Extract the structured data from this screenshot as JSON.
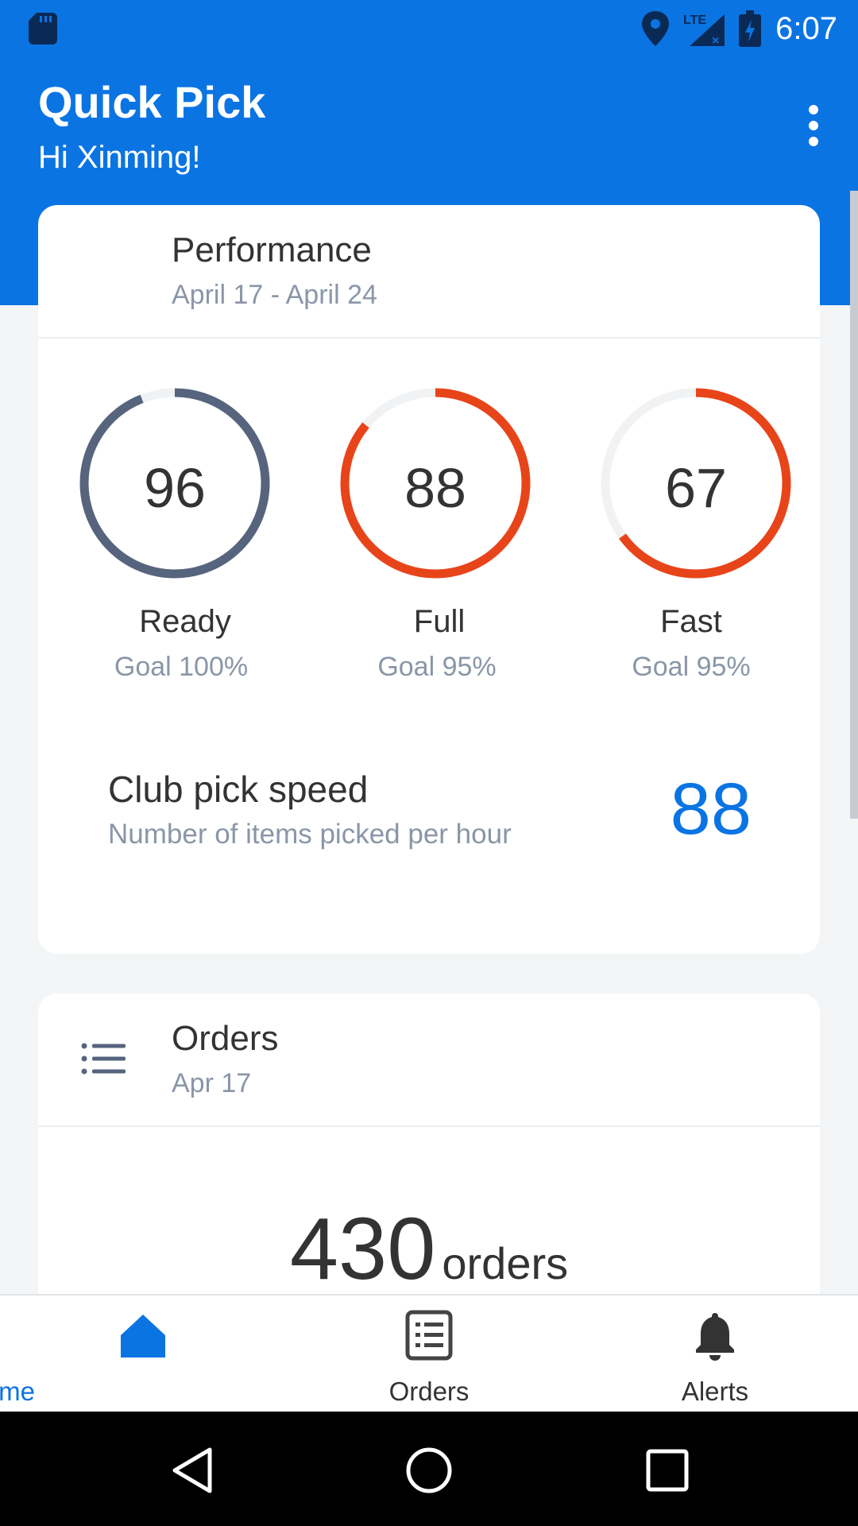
{
  "status_bar": {
    "time": "6:07",
    "network": "LTE"
  },
  "header": {
    "title": "Quick Pick",
    "greeting": "Hi Xinming!"
  },
  "performance": {
    "title": "Performance",
    "date_range": "April 17 - April 24",
    "metrics": [
      {
        "label": "Ready",
        "value": "96",
        "goal": "Goal 100%",
        "progress": 0.96,
        "color": "#56647e"
      },
      {
        "label": "Full",
        "value": "88",
        "goal": "Goal 95%",
        "progress": 0.88,
        "color": "#e8441a"
      },
      {
        "label": "Fast",
        "value": "67",
        "goal": "Goal 95%",
        "progress": 0.67,
        "color": "#e8441a"
      }
    ],
    "club_pick_speed": {
      "title": "Club pick speed",
      "subtitle": "Number of items picked per hour",
      "value": "88"
    }
  },
  "orders_card": {
    "title": "Orders",
    "date": "Apr 17",
    "count": "430",
    "unit": "orders"
  },
  "bottom_nav": {
    "items": [
      {
        "label": "Home",
        "icon": "home-icon",
        "active": true
      },
      {
        "label": "Orders",
        "icon": "orders-list-icon",
        "active": false
      },
      {
        "label": "Alerts",
        "icon": "bell-icon",
        "active": false
      }
    ]
  },
  "colors": {
    "brand": "#0b74e3",
    "ring_track": "#f1f2f4",
    "muted_text": "#8a96a8"
  }
}
